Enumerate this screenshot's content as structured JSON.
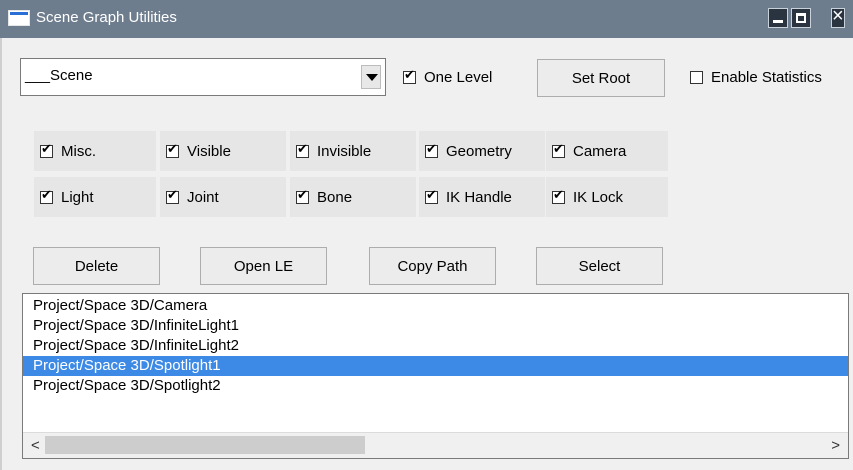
{
  "window": {
    "title": "Scene Graph Utilities"
  },
  "toolbar": {
    "scene_select_value": "___Scene",
    "one_level_label": "One Level",
    "one_level_checked": true,
    "set_root_label": "Set Root",
    "enable_statistics_label": "Enable Statistics",
    "enable_statistics_checked": false
  },
  "filters": [
    {
      "label": "Misc.",
      "checked": true
    },
    {
      "label": "Visible",
      "checked": true
    },
    {
      "label": "Invisible",
      "checked": true
    },
    {
      "label": "Geometry",
      "checked": true
    },
    {
      "label": "Camera",
      "checked": true
    },
    {
      "label": "Light",
      "checked": true
    },
    {
      "label": "Joint",
      "checked": true
    },
    {
      "label": "Bone",
      "checked": true
    },
    {
      "label": "IK Handle",
      "checked": true
    },
    {
      "label": "IK Lock",
      "checked": true
    }
  ],
  "actions": {
    "delete_label": "Delete",
    "open_le_label": "Open LE",
    "copy_path_label": "Copy Path",
    "select_label": "Select"
  },
  "paths": [
    {
      "text": "Project/Space 3D/Camera",
      "selected": false
    },
    {
      "text": "Project/Space 3D/InfiniteLight1",
      "selected": false
    },
    {
      "text": "Project/Space 3D/InfiniteLight2",
      "selected": false
    },
    {
      "text": "Project/Space 3D/Spotlight1",
      "selected": true
    },
    {
      "text": "Project/Space 3D/Spotlight2",
      "selected": false
    }
  ],
  "scrollbar": {
    "left_arrow": "<",
    "right_arrow": ">"
  },
  "colors": {
    "titlebar": "#6e7d8e",
    "selection": "#3c8ae6"
  }
}
